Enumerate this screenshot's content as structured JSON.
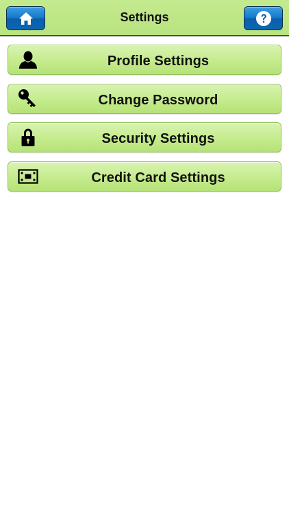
{
  "header": {
    "title": "Settings",
    "home_icon": "home-icon",
    "help_icon": "help-icon",
    "header_color": "#bde584",
    "button_color": "#1479c8"
  },
  "menu": {
    "items": [
      {
        "label": "Profile Settings",
        "icon": "user-icon"
      },
      {
        "label": "Change Password",
        "icon": "key-icon"
      },
      {
        "label": "Security Settings",
        "icon": "lock-icon"
      },
      {
        "label": "Credit Card Settings",
        "icon": "credit-card-icon"
      }
    ],
    "item_color": "#c6ec8f"
  }
}
